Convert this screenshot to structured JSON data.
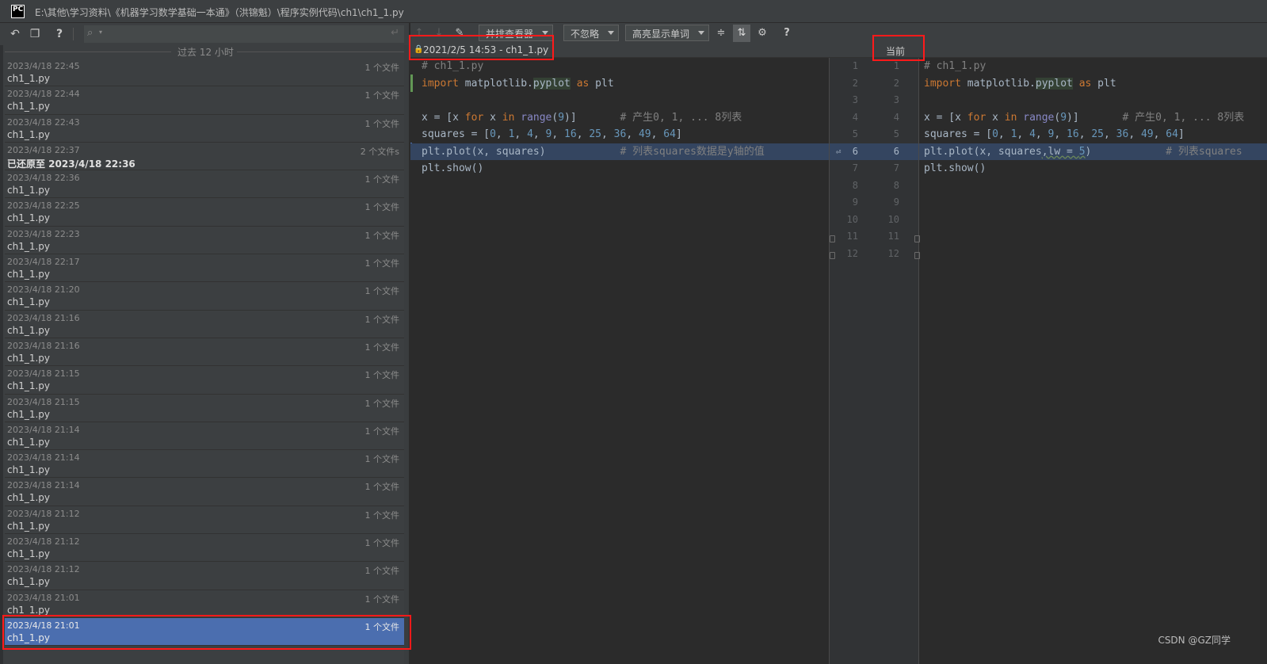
{
  "window": {
    "logo": "PC",
    "title": "E:\\其他\\学习资料\\《机器学习数学基础一本通》（洪锦魁）\\程序实例代码\\ch1\\ch1_1.py"
  },
  "left_panel": {
    "toolbar": {
      "revert_icon": "↶",
      "clipboard_icon": "❐",
      "help_label": "?",
      "search_icon": "⌕",
      "search_caret": "▾",
      "search_placeholder": "",
      "enter_icon": "↵"
    },
    "group_header": "过去 12 小时",
    "items": [
      {
        "date": "2023/4/18 22:45",
        "count": "1 个文件",
        "name": "ch1_1.py"
      },
      {
        "date": "2023/4/18 22:44",
        "count": "1 个文件",
        "name": "ch1_1.py"
      },
      {
        "date": "2023/4/18 22:43",
        "count": "1 个文件",
        "name": "ch1_1.py"
      },
      {
        "date": "2023/4/18 22:37",
        "count": "2 个文件s",
        "name": "已还原至 2023/4/18 22:36",
        "bold": true
      },
      {
        "date": "2023/4/18 22:36",
        "count": "1 个文件",
        "name": "ch1_1.py"
      },
      {
        "date": "2023/4/18 22:25",
        "count": "1 个文件",
        "name": "ch1_1.py"
      },
      {
        "date": "2023/4/18 22:23",
        "count": "1 个文件",
        "name": "ch1_1.py"
      },
      {
        "date": "2023/4/18 22:17",
        "count": "1 个文件",
        "name": "ch1_1.py"
      },
      {
        "date": "2023/4/18 21:20",
        "count": "1 个文件",
        "name": "ch1_1.py"
      },
      {
        "date": "2023/4/18 21:16",
        "count": "1 个文件",
        "name": "ch1_1.py"
      },
      {
        "date": "2023/4/18 21:16",
        "count": "1 个文件",
        "name": "ch1_1.py"
      },
      {
        "date": "2023/4/18 21:15",
        "count": "1 个文件",
        "name": "ch1_1.py"
      },
      {
        "date": "2023/4/18 21:15",
        "count": "1 个文件",
        "name": "ch1_1.py"
      },
      {
        "date": "2023/4/18 21:14",
        "count": "1 个文件",
        "name": "ch1_1.py"
      },
      {
        "date": "2023/4/18 21:14",
        "count": "1 个文件",
        "name": "ch1_1.py"
      },
      {
        "date": "2023/4/18 21:14",
        "count": "1 个文件",
        "name": "ch1_1.py"
      },
      {
        "date": "2023/4/18 21:12",
        "count": "1 个文件",
        "name": "ch1_1.py"
      },
      {
        "date": "2023/4/18 21:12",
        "count": "1 个文件",
        "name": "ch1_1.py"
      },
      {
        "date": "2023/4/18 21:12",
        "count": "1 个文件",
        "name": "ch1_1.py"
      },
      {
        "date": "2023/4/18 21:01",
        "count": "1 个文件",
        "name": "ch1_1.py"
      },
      {
        "date": "2023/4/18 21:01",
        "count": "1 个文件",
        "name": "ch1_1.py",
        "selected": true
      }
    ]
  },
  "diff_toolbar": {
    "prev_icon": "↑",
    "next_icon": "↓",
    "edit_icon": "✎",
    "viewer_combo": "并排查看器",
    "ignore_combo": "不忽略",
    "highlight_combo": "高亮显示单词",
    "collapse_icon": "≑",
    "sync_icon": "⇅",
    "settings_icon": "⚙",
    "help_label": "?"
  },
  "diff_header": {
    "lock_icon": "🔒",
    "left_title": "2021/2/5 14:53 - ch1_1.py",
    "right_title": "当前"
  },
  "gutter": {
    "merge_icon": "⏎",
    "left_numbers": [
      "1",
      "2",
      "3",
      "4",
      "5",
      "6",
      "7",
      "8",
      "9",
      "10",
      "11",
      "12"
    ],
    "right_numbers": [
      "1",
      "2",
      "3",
      "4",
      "5",
      "6",
      "7",
      "8",
      "9",
      "10",
      "11",
      "12"
    ]
  },
  "left_code": [
    "# ch1_1.py",
    "import matplotlib.pyplot as plt",
    "",
    "x = [x for x in range(9)]       # 产生0, 1, ... 8列表",
    "squares = [0, 1, 4, 9, 16, 25, 36, 49, 64]",
    "plt.plot(x, squares)            # 列表squares数据是y轴的值",
    "plt.show()"
  ],
  "right_code": [
    "# ch1_1.py",
    "import matplotlib.pyplot as plt",
    "",
    "x = [x for x in range(9)]       # 产生0, 1, ... 8列表",
    "squares = [0, 1, 4, 9, 16, 25, 36, 49, 64]",
    "plt.plot(x, squares,lw = 5)            # 列表squares",
    "plt.show()"
  ],
  "highlighted_line": 6,
  "watermark": "CSDN @GZ同学",
  "colors": {
    "annotation": "#ff1a1a",
    "selection": "#4b6eaf",
    "diff_highlight": "#344560",
    "keyword": "#cc7832",
    "number": "#6897bb",
    "comment": "#808080"
  }
}
